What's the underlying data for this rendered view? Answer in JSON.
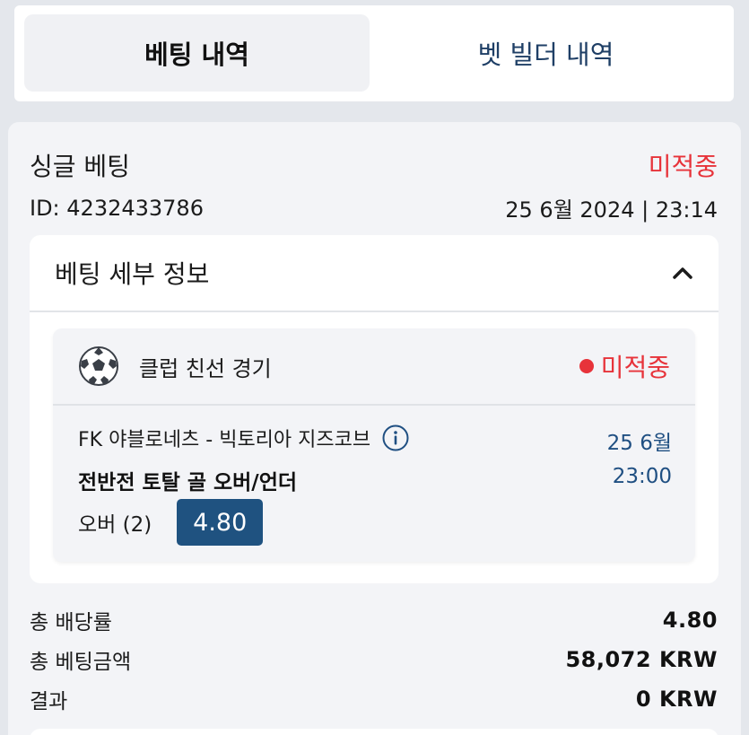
{
  "tabs": [
    {
      "label": "베팅 내역",
      "active": true
    },
    {
      "label": "벳 빌더 내역",
      "active": false
    }
  ],
  "bet": {
    "type": "싱글 베팅",
    "status": "미적중",
    "id": "ID: 4232433786",
    "datetime": "25 6월 2024 | 23:14"
  },
  "details": {
    "title": "베팅 세부 정보",
    "selection": {
      "competition": "클럽 친선 경기",
      "status": "미적중",
      "match": "FK 야블로네츠 - 빅토리아 지즈코브",
      "market": "전반전 토탈 골 오버/언더",
      "pick": "오버 (2)",
      "odds": "4.80",
      "date": "25 6월",
      "time": "23:00"
    }
  },
  "summary": [
    {
      "label": "총 배당률",
      "value": "4.80"
    },
    {
      "label": "총 베팅금액",
      "value": "58,072 KRW"
    },
    {
      "label": "결과",
      "value": "0 KRW"
    }
  ],
  "colors": {
    "lost": "#e7333a",
    "accent": "#1f5280",
    "link": "#1f4f82"
  },
  "icons": {
    "sport": "soccer-ball-icon",
    "collapse": "chevron-up-icon",
    "info": "info-icon"
  }
}
